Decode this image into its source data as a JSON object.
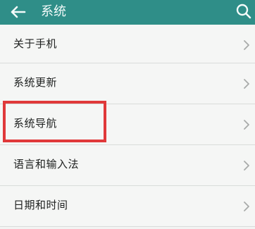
{
  "header": {
    "title": "系统",
    "back_icon": "arrow-left-icon",
    "search_icon": "search-icon"
  },
  "settings": {
    "items": [
      {
        "label": "关于手机",
        "chevron_icon": "chevron-right-icon"
      },
      {
        "label": "系统更新",
        "chevron_icon": "chevron-right-icon"
      },
      {
        "label": "系统导航",
        "chevron_icon": "chevron-right-icon",
        "highlighted": true
      },
      {
        "label": "语言和输入法",
        "chevron_icon": "chevron-right-icon"
      },
      {
        "label": "日期和时间",
        "chevron_icon": "chevron-right-icon"
      }
    ]
  },
  "colors": {
    "header": "#2f8e88",
    "highlight": "#e0393a",
    "background": "#f5f6f5"
  }
}
